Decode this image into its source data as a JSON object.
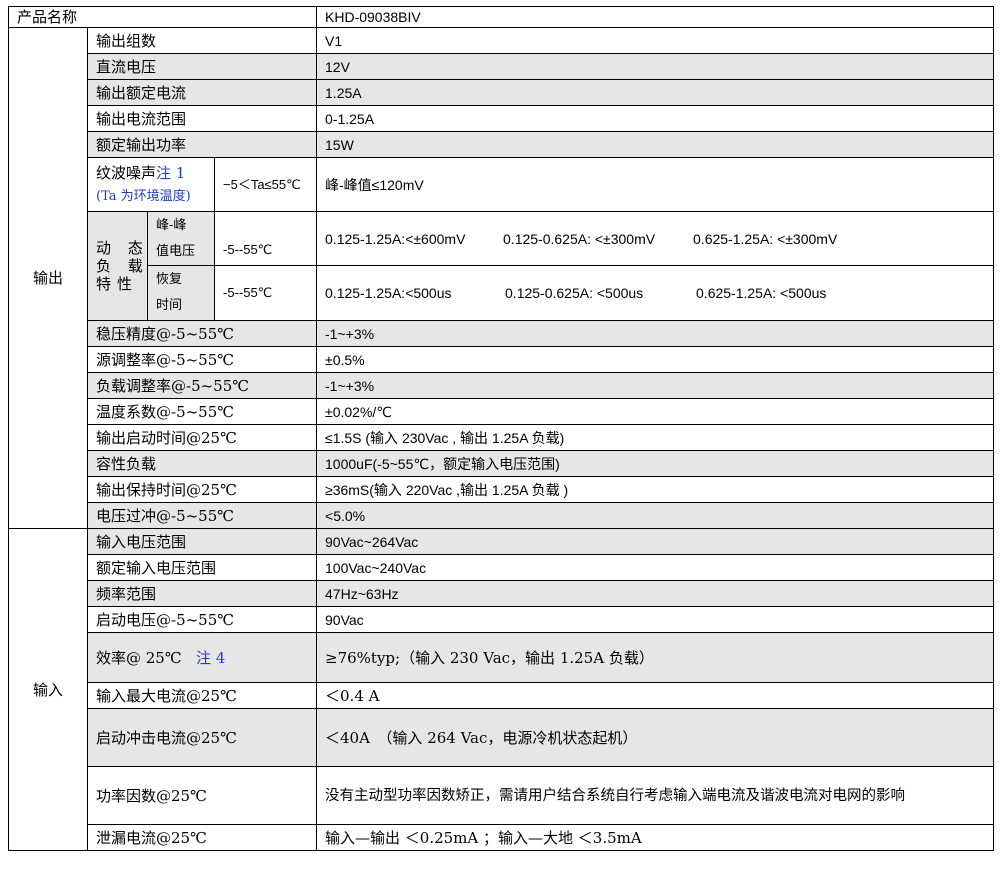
{
  "product": {
    "label": "产品名称",
    "value": "KHD-09038BIV"
  },
  "output": {
    "label": "输出",
    "rows_top": [
      {
        "label": "输出组数",
        "value": "V1"
      },
      {
        "label": "直流电压",
        "value": "12V"
      },
      {
        "label": "输出额定电流",
        "value": "1.25A"
      },
      {
        "label": "输出电流范围",
        "value": "0-1.25A"
      },
      {
        "label": "额定输出功率",
        "value": "15W"
      }
    ],
    "ripple": {
      "label": "纹波噪声",
      "note": "注 1",
      "note2": "(Ta 为环境温度)",
      "condition": "−5＜Ta≤55℃",
      "value": "峰-峰值≤120mV"
    },
    "dynamic": {
      "label_lines": [
        "动 态",
        "负 载",
        "特性"
      ],
      "peak": {
        "label_lines": [
          "峰-峰",
          "值电压"
        ],
        "condition": "-5--55℃",
        "values": [
          "0.125-1.25A:<±600mV",
          "0.125-0.625A: <±300mV",
          "0.625-1.25A: <±300mV"
        ]
      },
      "recovery": {
        "label_lines": [
          "恢复",
          "时间"
        ],
        "condition": "-5--55℃",
        "values": [
          "0.125-1.25A:<500us",
          "0.125-0.625A: <500us",
          "0.625-1.25A: <500us"
        ]
      }
    },
    "rows_bottom": [
      {
        "label": "稳压精度@-5~55℃",
        "value": "-1~+3%"
      },
      {
        "label": "源调整率@-5~55℃",
        "value": "±0.5%"
      },
      {
        "label": "负载调整率@-5~55℃",
        "value": "-1~+3%"
      },
      {
        "label": "温度系数@-5~55℃",
        "value": "±0.02%/℃"
      },
      {
        "label": "输出启动时间@25℃",
        "value": "≤1.5S (输入 230Vac , 输出 1.25A 负载)"
      },
      {
        "label": "容性负载",
        "value": "1000uF(-5~55℃，额定输入电压范围)"
      },
      {
        "label": "输出保持时间@25℃",
        "value": "≥36mS(输入 220Vac ,输出 1.25A 负载 )"
      },
      {
        "label": "电压过冲@-5~55℃",
        "value": "<5.0%"
      }
    ]
  },
  "input": {
    "label": "输入",
    "rows": [
      {
        "label": "输入电压范围",
        "value": "90Vac~264Vac"
      },
      {
        "label": "额定输入电压范围",
        "value": "100Vac~240Vac"
      },
      {
        "label": "频率范围",
        "value": "47Hz~63Hz"
      },
      {
        "label": "启动电压@-5~55℃",
        "value": "90Vac"
      }
    ],
    "efficiency": {
      "label": "效率@ 25℃",
      "note": "注 4",
      "value": "≥76%typ;（输入 230 Vac，输出 1.25A 负载）"
    },
    "max_current": {
      "label": "输入最大电流@25℃",
      "value": "＜0.4 A"
    },
    "inrush": {
      "label": "启动冲击电流@25℃",
      "value": "＜40A　（输入 264 Vac，电源冷机状态起机）"
    },
    "pf": {
      "label": "功率因数@25℃",
      "value": "没有主动型功率因数矫正，需请用户结合系统自行考虑输入端电流及谐波电流对电网的影响"
    },
    "leakage": {
      "label": "泄漏电流@25℃",
      "value": "输入—输出 ＜0.25mA ；输入—大地 ＜3.5mA"
    }
  }
}
